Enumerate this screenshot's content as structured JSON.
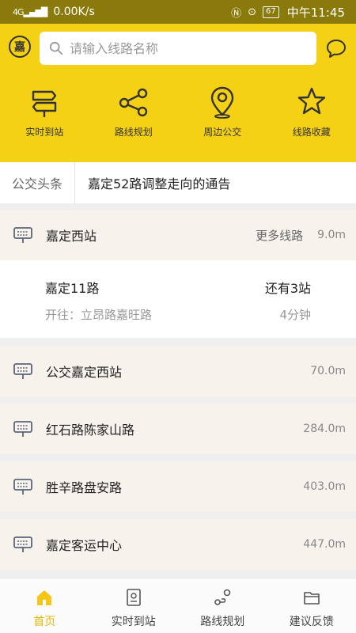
{
  "status_bar": {
    "network": "4G",
    "speed": "0.00K/s",
    "battery": "67",
    "time": "中午11:45"
  },
  "header": {
    "logo_char": "嘉",
    "search_placeholder": "请输入线路名称",
    "quick_actions": [
      {
        "label": "实时到站",
        "icon": "transfer-arrows-icon"
      },
      {
        "label": "路线规划",
        "icon": "share-nodes-icon"
      },
      {
        "label": "周边公交",
        "icon": "location-pin-icon"
      },
      {
        "label": "线路收藏",
        "icon": "star-icon"
      }
    ]
  },
  "news": {
    "tag": "公交头条",
    "headline": "嘉定52路调整走向的通告"
  },
  "stations": [
    {
      "name": "嘉定西站",
      "more": "更多线路",
      "distance": "9.0m"
    },
    {
      "name": "公交嘉定西站",
      "distance": "70.0m"
    },
    {
      "name": "红石路陈家山路",
      "distance": "284.0m"
    },
    {
      "name": "胜辛路盘安路",
      "distance": "403.0m"
    },
    {
      "name": "嘉定客运中心",
      "distance": "447.0m"
    }
  ],
  "route": {
    "name": "嘉定11路",
    "stops_left": "还有3站",
    "direction": "开往：立昂路嘉旺路",
    "eta": "4分钟"
  },
  "tabbar": [
    {
      "label": "首页",
      "active": true
    },
    {
      "label": "实时到站"
    },
    {
      "label": "路线规划"
    },
    {
      "label": "建议反馈"
    }
  ],
  "colors": {
    "brand_yellow": "#f5d115",
    "status_bar": "#8a7a0c",
    "active_tab": "#e9b800"
  }
}
